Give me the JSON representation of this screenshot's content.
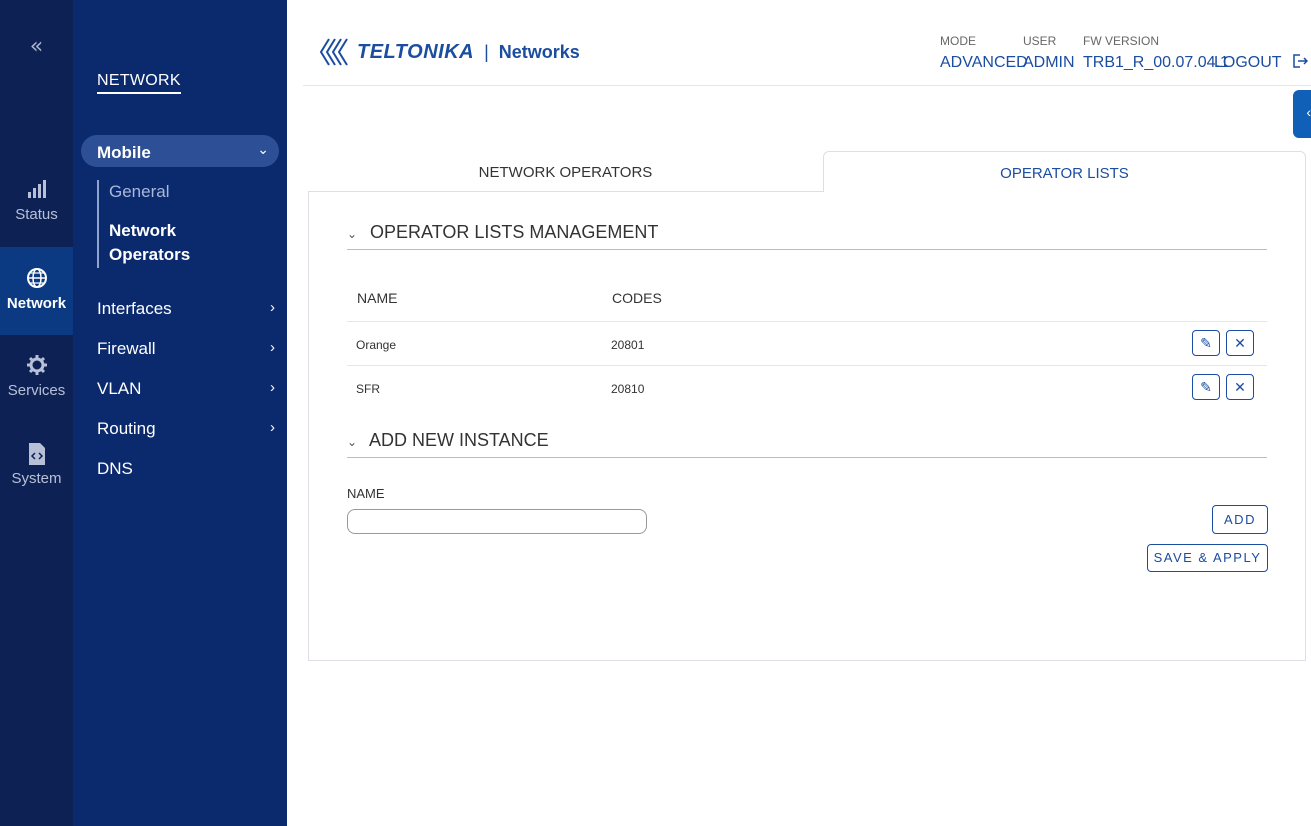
{
  "rail": {
    "collapse": "«",
    "items": [
      {
        "label": "Status",
        "icon": "signal-icon"
      },
      {
        "label": "Network",
        "icon": "globe-icon"
      },
      {
        "label": "Services",
        "icon": "gear-icon"
      },
      {
        "label": "System",
        "icon": "file-code-icon"
      }
    ]
  },
  "sidebar": {
    "title": "NETWORK",
    "mobile": "Mobile",
    "mobile_children": [
      "General",
      "Network\nOperators"
    ],
    "items": [
      "Interfaces",
      "Firewall",
      "VLAN",
      "Routing",
      "DNS"
    ]
  },
  "header": {
    "brand": "TELTONIKA",
    "brand_sub": "Networks",
    "mode_label": "MODE",
    "mode_value": "ADVANCED",
    "user_label": "USER",
    "user_value": "ADMIN",
    "fw_label": "FW VERSION",
    "fw_value": "TRB1_R_00.07.04.1",
    "logout": "LOGOUT"
  },
  "tabs": [
    "NETWORK OPERATORS",
    "OPERATOR LISTS"
  ],
  "section1": {
    "title": "OPERATOR LISTS MANAGEMENT",
    "columns": [
      "NAME",
      "CODES"
    ],
    "rows": [
      {
        "name": "Orange",
        "codes": "20801"
      },
      {
        "name": "SFR",
        "codes": "20810"
      }
    ]
  },
  "section2": {
    "title": "ADD NEW INSTANCE",
    "name_label": "NAME",
    "name_value": "",
    "add": "ADD",
    "save": "SAVE & APPLY"
  },
  "colors": {
    "accent": "#1b4da0",
    "sidebar": "#0b2a6e",
    "rail": "#0e2154"
  }
}
